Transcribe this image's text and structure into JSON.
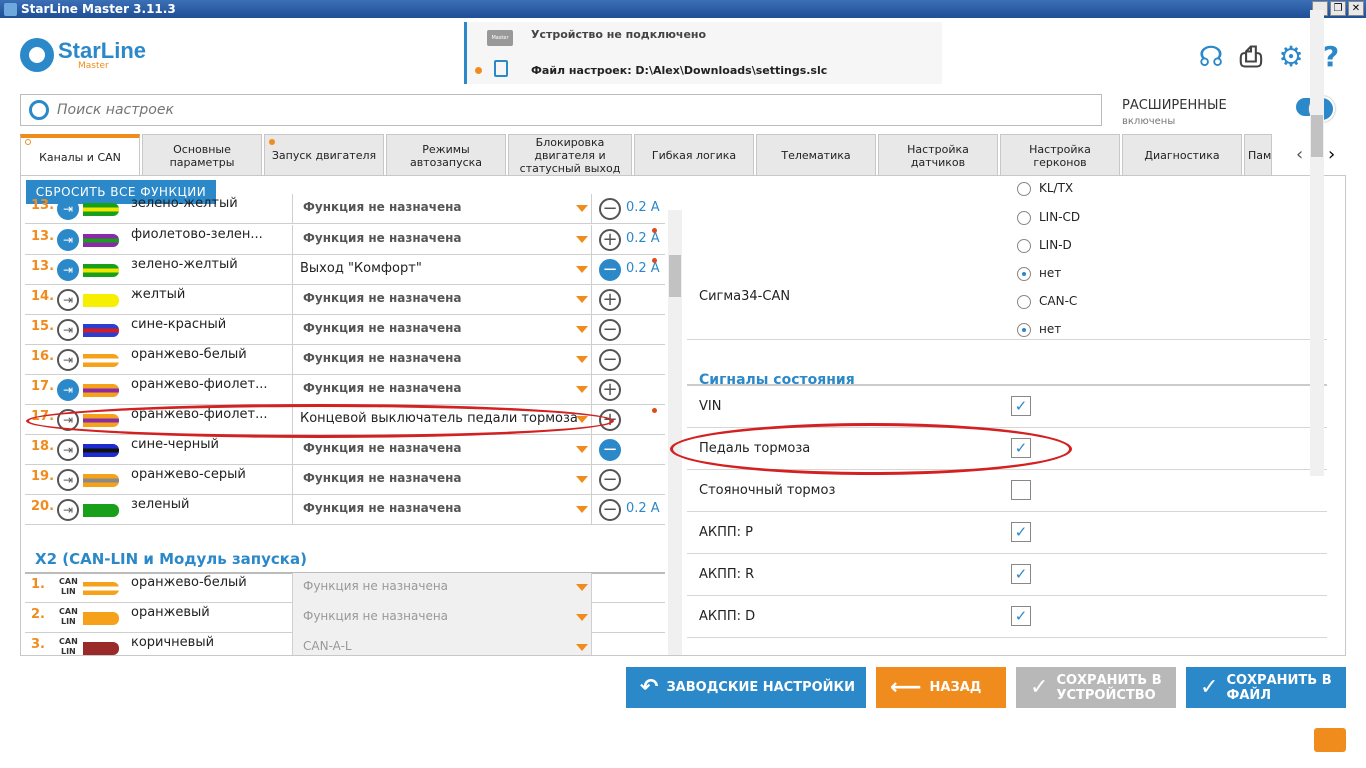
{
  "window": {
    "title": "StarLine Master 3.11.3",
    "buttons": [
      "_",
      "❐",
      "✕"
    ]
  },
  "logo": {
    "brand": "StarLine",
    "sub": "Master"
  },
  "device": {
    "status": "Устройство не подключено",
    "file": "Файл настроек: D:\\Alex\\Downloads\\settings.slc",
    "device_chip": "Master"
  },
  "search": {
    "placeholder": "Поиск настроек"
  },
  "advanced": {
    "label": "РАСШИРЕННЫЕ",
    "state": "включены",
    "enabled": true
  },
  "tabs": [
    {
      "label": "Каналы и CAN",
      "active": true,
      "dot": true
    },
    {
      "label": "Основные параметры",
      "dot": false
    },
    {
      "label": "Запуск двигателя",
      "dot": true
    },
    {
      "label": "Режимы автозапуска",
      "dot": false
    },
    {
      "label": "Блокировка двигателя и статусный выход",
      "dot": false
    },
    {
      "label": "Гибкая логика",
      "dot": false
    },
    {
      "label": "Телематика",
      "dot": false
    },
    {
      "label": "Настройка датчиков",
      "dot": false
    },
    {
      "label": "Настройка герконов",
      "dot": false
    },
    {
      "label": "Диагностика",
      "dot": false
    },
    {
      "label": "Пам",
      "dot": false
    }
  ],
  "nav": {
    "prev": "‹",
    "next": "›"
  },
  "reset_all": "СБРОСИТЬ ВСЕ ФУНКЦИИ",
  "channels": [
    {
      "num": "13.",
      "wire": "зелено-желтый",
      "func": "Функция не назначена",
      "pm": "−",
      "amp": "0.2 A",
      "dir_on": true,
      "pm_on": false,
      "c1": "#18a01a",
      "c2": "#f2e600",
      "partial": true
    },
    {
      "num": "13.",
      "wire": "фиолетово-зелен...",
      "func": "Функция не назначена",
      "pm": "+",
      "amp": "0.2 A",
      "dir_on": true,
      "pm_on": false,
      "c1": "#8a2aa6",
      "c2": "#18a01a",
      "dot": true
    },
    {
      "num": "13.",
      "wire": "зелено-желтый",
      "func": "Выход \"Комфорт\"",
      "pm": "−",
      "amp": "0.2 A",
      "dir_on": true,
      "pm_on": true,
      "c1": "#18a01a",
      "c2": "#f2e600",
      "set": true,
      "dot": true
    },
    {
      "num": "14.",
      "wire": "желтый",
      "func": "Функция не назначена",
      "pm": "+",
      "amp": "",
      "dir_on": false,
      "pm_on": false,
      "c1": "#f7ef00",
      "c2": "#f7ef00"
    },
    {
      "num": "15.",
      "wire": "сине-красный",
      "func": "Функция не назначена",
      "pm": "−",
      "amp": "",
      "dir_on": false,
      "pm_on": false,
      "c1": "#2b3ed1",
      "c2": "#d61e1e"
    },
    {
      "num": "16.",
      "wire": "оранжево-белый",
      "func": "Функция не назначена",
      "pm": "−",
      "amp": "",
      "dir_on": false,
      "pm_on": false,
      "c1": "#f5a21a",
      "c2": "#ffffff"
    },
    {
      "num": "17.",
      "wire": "оранжево-фиолет...",
      "func": "Функция не назначена",
      "pm": "+",
      "amp": "",
      "dir_on": true,
      "pm_on": false,
      "c1": "#f5a21a",
      "c2": "#8a2aa6"
    },
    {
      "num": "17.",
      "wire": "оранжево-фиолет...",
      "func": "Концевой выключатель педали тормоза",
      "pm": "+",
      "amp": "",
      "dir_on": false,
      "pm_on": false,
      "c1": "#f5a21a",
      "c2": "#8a2aa6",
      "set": true,
      "dot": true
    },
    {
      "num": "18.",
      "wire": "сине-черный",
      "func": "Функция не назначена",
      "pm": "−",
      "amp": "",
      "dir_on": false,
      "pm_on": true,
      "c1": "#1e2bd1",
      "c2": "#111111"
    },
    {
      "num": "19.",
      "wire": "оранжево-серый",
      "func": "Функция не назначена",
      "pm": "−",
      "amp": "",
      "dir_on": false,
      "pm_on": false,
      "c1": "#f5a21a",
      "c2": "#8a8a8a"
    },
    {
      "num": "20.",
      "wire": "зеленый",
      "func": "Функция не назначена",
      "pm": "−",
      "amp": "0.2 A",
      "dir_on": false,
      "pm_on": false,
      "c1": "#18a01a",
      "c2": "#18a01a"
    }
  ],
  "x2": {
    "title": "X2 (CAN-LIN и Модуль запуска)",
    "can_label": "CAN",
    "lin_label": "LIN",
    "rows": [
      {
        "num": "1.",
        "wire": "оранжево-белый",
        "func": "Функция не назначена",
        "c1": "#f5a21a",
        "c2": "#ffffff"
      },
      {
        "num": "2.",
        "wire": "оранжевый",
        "func": "Функция не назначена",
        "c1": "#f5a21a",
        "c2": "#f5a21a"
      },
      {
        "num": "3.",
        "wire": "коричневый",
        "func": "CAN-A-L",
        "c1": "#9a2a2a",
        "c2": "#9a2a2a"
      }
    ]
  },
  "right": {
    "radios_top": [
      {
        "label": "KL/TX",
        "selected": false
      },
      {
        "label": "LIN-CD",
        "selected": false
      },
      {
        "label": "LIN-D",
        "selected": false
      },
      {
        "label": "нет",
        "selected": true
      }
    ],
    "sigma": {
      "label": "Сигма34-CAN",
      "options": [
        {
          "label": "CAN-C",
          "selected": false
        },
        {
          "label": "нет",
          "selected": true
        }
      ]
    },
    "section": "Сигналы состояния",
    "signals": [
      {
        "label": "VIN",
        "checked": true
      },
      {
        "label": "Педаль тормоза",
        "checked": true
      },
      {
        "label": "Стояночный тормоз",
        "checked": false
      },
      {
        "label": "АКПП: P",
        "checked": true
      },
      {
        "label": "АКПП: R",
        "checked": true
      },
      {
        "label": "АКПП: D",
        "checked": true
      }
    ],
    "check_mark": "✓"
  },
  "buttons": {
    "factory": "ЗАВОДСКИЕ НАСТРОЙКИ",
    "back": "НАЗАД",
    "save_device_1": "СОХРАНИТЬ В",
    "save_device_2": "УСТРОЙСТВО",
    "save_file_1": "СОХРАНИТЬ В",
    "save_file_2": "ФАЙЛ"
  },
  "colors": {
    "accent": "#2b88c9",
    "orange": "#f08c1d",
    "highlight": "#d42020",
    "disabled_button": "#b8b8b8"
  }
}
